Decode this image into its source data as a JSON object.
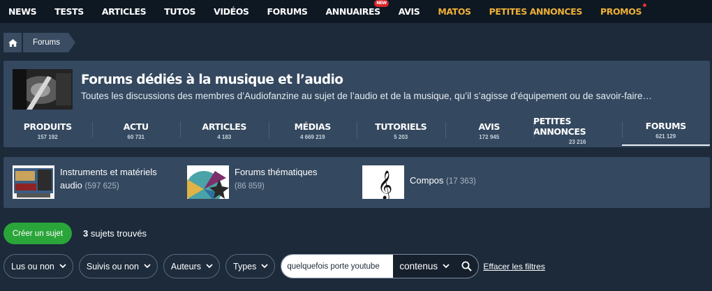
{
  "topnav": [
    {
      "label": "NEWS"
    },
    {
      "label": "TESTS"
    },
    {
      "label": "ARTICLES"
    },
    {
      "label": "TUTOS"
    },
    {
      "label": "VIDÉOS"
    },
    {
      "label": "FORUMS"
    },
    {
      "label": "ANNUAIRES",
      "badge": "NEW"
    },
    {
      "label": "AVIS"
    },
    {
      "label": "MATOS"
    },
    {
      "label": "PETITES ANNONCES"
    },
    {
      "label": "PROMOS"
    }
  ],
  "colors": {
    "gold": "#f0b035",
    "green": "#2aa53a",
    "badge_red": "#d9262b"
  },
  "breadcrumb": {
    "home_icon": "home-icon",
    "current": "Forums"
  },
  "header": {
    "title": "Forums dédiés à la musique et l’audio",
    "description": "Toutes les discussions des membres d’Audiofanzine au sujet de l’audio et de la musique, qu’il s’agisse d’équipement ou de savoir-faire…"
  },
  "tabs": [
    {
      "label": "PRODUITS",
      "count": "157 192"
    },
    {
      "label": "ACTU",
      "count": "60 731"
    },
    {
      "label": "ARTICLES",
      "count": "4 183"
    },
    {
      "label": "MÉDIAS",
      "count": "4 669 219"
    },
    {
      "label": "TUTORIELS",
      "count": "5 203"
    },
    {
      "label": "AVIS",
      "count": "172 945"
    },
    {
      "label": "PETITES ANNONCES",
      "count": "23 216"
    },
    {
      "label": "FORUMS",
      "count": "621 129",
      "active": true
    }
  ],
  "categories": [
    {
      "name_line1": "Instruments et matériels",
      "name_line2": "audio",
      "count": "(597 625)"
    },
    {
      "name_line1": "Forums thématiques",
      "count": "(86 859)"
    },
    {
      "name_line1": "Compos",
      "count": "(17 363)"
    }
  ],
  "actions": {
    "create_label": "Créer un sujet",
    "found_count": "3",
    "found_text": " sujets trouvés"
  },
  "filters": {
    "read": "Lus ou non",
    "followed": "Suivis ou non",
    "authors": "Auteurs",
    "types": "Types",
    "search_value": "quelquefois porte youtube",
    "search_scope": "contenus",
    "clear": "Effacer les filtres"
  }
}
